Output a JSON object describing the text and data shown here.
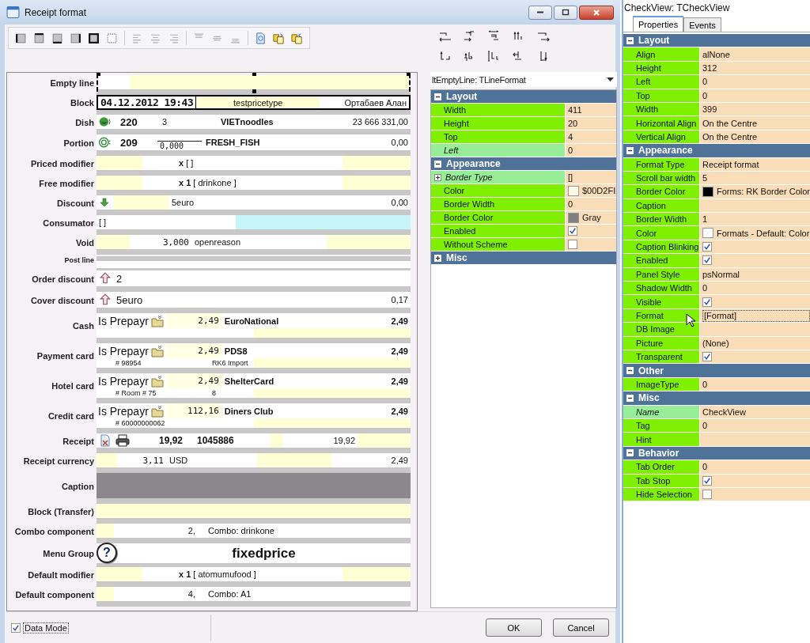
{
  "window": {
    "title": "Receipt format"
  },
  "lines": [
    {
      "label": "Empty line",
      "kind": "empty",
      "selected": true
    },
    {
      "label": "Block",
      "kind": "block",
      "datetime": "04.12.2012 19:43",
      "price_type": "testpricetype",
      "waiter": "Ортабаев Алан"
    },
    {
      "label": "Dish",
      "kind": "dish",
      "code": "220",
      "qty": "3",
      "name": "VIETnoodles",
      "sum": "23 666 331,00"
    },
    {
      "label": "Portion",
      "kind": "portion",
      "code": "209",
      "qty": "0,000",
      "name": "FRESH_FISH",
      "sum": "0,00"
    },
    {
      "label": "Priced modifier",
      "kind": "modifier",
      "qty": "x",
      "name": "[ ]"
    },
    {
      "label": "Free modifier",
      "kind": "modifier",
      "qty": "x 1",
      "name": "[ drinkone ]"
    },
    {
      "label": "Discount",
      "kind": "discount",
      "name": "5euro",
      "sum": "0,00"
    },
    {
      "label": "Consumator",
      "kind": "consumator",
      "name": "[ ]"
    },
    {
      "label": "Void",
      "kind": "void",
      "qty": "3,000",
      "reason": "openreason"
    },
    {
      "label": "Post line",
      "kind": "post"
    },
    {
      "label": "Order discount",
      "kind": "markup",
      "name": "2"
    },
    {
      "label": "Cover discount",
      "kind": "markup",
      "name": "5euro",
      "sum": "0,17"
    },
    {
      "label": "Cash",
      "kind": "payment",
      "prepay": "Is Prepayr",
      "amount": "2,49",
      "name": "EuroNational",
      "total": "2,49"
    },
    {
      "label": "Payment card",
      "kind": "payment",
      "prepay": "Is Prepayr",
      "amount": "2,49",
      "name": "PDS8",
      "total": "2,49",
      "number": "# 98954",
      "note": "RK6 Import"
    },
    {
      "label": "Hotel card",
      "kind": "payment",
      "prepay": "Is Prepayr",
      "amount": "2,49",
      "name": "ShelterCard",
      "total": "2,49",
      "number": "# Room # 75",
      "note": "8"
    },
    {
      "label": "Credit card",
      "kind": "payment",
      "prepay": "Is Prepayr",
      "amount": "112,16",
      "name": "Diners Club",
      "total": "2,49",
      "number": "# 60000000062"
    },
    {
      "label": "Receipt",
      "kind": "receipt",
      "total": "19,92",
      "number": "1045886",
      "sum": "19,92"
    },
    {
      "label": "Receipt currency",
      "kind": "currency",
      "amount": "3,11",
      "currency": "USD",
      "sum": "2,49"
    },
    {
      "label": "Caption",
      "kind": "caption"
    },
    {
      "label": "Block (Transfer)",
      "kind": "blank"
    },
    {
      "label": "Combo component",
      "kind": "combo",
      "num": "2,",
      "name": "Combo: drinkone"
    },
    {
      "label": "Menu Group",
      "kind": "group",
      "symbol": "?",
      "name": "fixedprice"
    },
    {
      "label": "Default modifier",
      "kind": "modifier",
      "qty": "x 1",
      "name": "[ atomumufood ]"
    },
    {
      "label": "Default component",
      "kind": "combo",
      "num": "4,",
      "name": "Combo: A1"
    }
  ],
  "data_mode": {
    "label": "Data Mode",
    "checked": true
  },
  "buttons": [
    "OK",
    "Cancel"
  ],
  "line_inspector": {
    "object": "ltEmptyLine: TLineFormat",
    "sections": [
      {
        "section": "Layout",
        "expanded": true,
        "items": [
          {
            "name": "Width",
            "kind": "text",
            "value": "411",
            "inherited": false
          },
          {
            "name": "Height",
            "kind": "text",
            "value": "20",
            "inherited": false
          },
          {
            "name": "Top",
            "kind": "text",
            "value": "4",
            "inherited": false
          },
          {
            "name": "Left",
            "kind": "text",
            "value": "0",
            "inherited": true
          }
        ]
      },
      {
        "section": "Appearance",
        "expanded": true,
        "items": [
          {
            "name": "Border Type",
            "kind": "group",
            "value": "[]",
            "expanded": false,
            "inherited": true
          },
          {
            "name": "Color",
            "kind": "color",
            "color": "#fbf8e6",
            "value": "$00D2FI",
            "inherited": false
          },
          {
            "name": "Border Width",
            "kind": "text",
            "value": "0",
            "inherited": false
          },
          {
            "name": "Border Color",
            "kind": "color",
            "color": "#808080",
            "value": "Gray",
            "inherited": false
          },
          {
            "name": "Enabled",
            "kind": "check",
            "checked": true,
            "inherited": false
          },
          {
            "name": "Without Scheme",
            "kind": "check",
            "checked": false,
            "inherited": false
          }
        ]
      },
      {
        "section": "Misc",
        "expanded": false
      }
    ]
  },
  "object_inspector": {
    "title": "CheckView: TCheckView",
    "tabs": [
      {
        "label": "Properties",
        "selected": true
      },
      {
        "label": "Events",
        "selected": false
      }
    ],
    "sections": [
      {
        "section": "Layout",
        "expanded": true,
        "items": [
          {
            "name": "Align",
            "kind": "text",
            "value": "alNone",
            "inherited": false
          },
          {
            "name": "Height",
            "kind": "text",
            "value": "312",
            "inherited": false
          },
          {
            "name": "Left",
            "kind": "text",
            "value": "0",
            "inherited": false
          },
          {
            "name": "Top",
            "kind": "text",
            "value": "0",
            "inherited": false
          },
          {
            "name": "Width",
            "kind": "text",
            "value": "399",
            "inherited": false
          },
          {
            "name": "Horizontal Align",
            "kind": "text",
            "value": "On the Centre",
            "inherited": false
          },
          {
            "name": "Vertical Align",
            "kind": "text",
            "value": "On the Centre",
            "inherited": false
          }
        ]
      },
      {
        "section": "Appearance",
        "expanded": true,
        "items": [
          {
            "name": "Format Type",
            "kind": "text",
            "value": "Receipt format",
            "inherited": false
          },
          {
            "name": "Scroll bar width",
            "kind": "text",
            "value": "5",
            "inherited": false
          },
          {
            "name": "Border Color",
            "kind": "color",
            "color": "#000000",
            "value": "Forms: RK Border Color",
            "inherited": false
          },
          {
            "name": "Caption",
            "kind": "text",
            "inherited": false
          },
          {
            "name": "Border Width",
            "kind": "text",
            "value": "1",
            "inherited": false
          },
          {
            "name": "Color",
            "kind": "color",
            "color": "#ffffff",
            "value": "Formats - Default: Color",
            "inherited": false
          },
          {
            "name": "Caption Blinking",
            "kind": "check",
            "checked": true,
            "inherited": false
          },
          {
            "name": "Enabled",
            "kind": "check",
            "checked": true,
            "inherited": false
          },
          {
            "name": "Panel Style",
            "kind": "text",
            "value": "psNormal",
            "inherited": false
          },
          {
            "name": "Shadow Width",
            "kind": "text",
            "value": "0",
            "inherited": false
          },
          {
            "name": "Visible",
            "kind": "check",
            "checked": true,
            "inherited": false
          },
          {
            "name": "Format",
            "kind": "edit",
            "value": "[Format]",
            "inherited": false
          },
          {
            "name": "DB Image",
            "kind": "text",
            "inherited": false
          },
          {
            "name": "Picture",
            "kind": "text",
            "value": "(None)",
            "inherited": false
          },
          {
            "name": "Transparent",
            "kind": "check",
            "checked": true,
            "inherited": false
          }
        ]
      },
      {
        "section": "Other",
        "expanded": true,
        "items": [
          {
            "name": "ImageType",
            "kind": "text",
            "value": "0",
            "inherited": false
          }
        ]
      },
      {
        "section": "Misc",
        "expanded": true,
        "items": [
          {
            "name": "Name",
            "kind": "text",
            "value": "CheckView",
            "inherited": true
          },
          {
            "name": "Tag",
            "kind": "text",
            "value": "0",
            "inherited": false
          },
          {
            "name": "Hint",
            "kind": "text",
            "inherited": false
          }
        ]
      },
      {
        "section": "Behavior",
        "expanded": true,
        "items": [
          {
            "name": "Tab Order",
            "kind": "text",
            "value": "0",
            "inherited": false
          },
          {
            "name": "Tab Stop",
            "kind": "check",
            "checked": true,
            "inherited": false
          },
          {
            "name": "Hide Selection",
            "kind": "check",
            "checked": false,
            "inherited": false
          }
        ]
      }
    ]
  }
}
